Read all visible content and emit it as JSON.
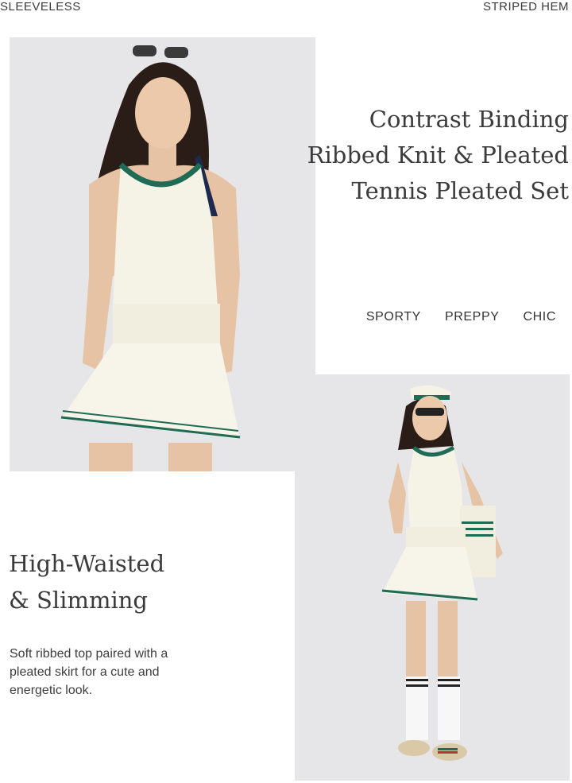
{
  "top_labels": {
    "left": "SLEEVELESS",
    "right": "STRIPED HEM"
  },
  "hero": {
    "title_lines": [
      "Contrast Binding",
      "Ribbed Knit & Pleated",
      "Tennis Pleated Set"
    ],
    "tags": [
      "SPORTY",
      "PREPPY",
      "CHIC"
    ]
  },
  "feature": {
    "title_lines": [
      "High-Waisted",
      "& Slimming"
    ],
    "description": "Soft ribbed top paired with a pleated skirt for a cute and energetic look."
  },
  "photos": {
    "photo1_alt": "Model wearing white ribbed tank top with green binding and pleated tennis skirt",
    "photo2_alt": "Model in white visor, tennis set, knee socks and sneakers holding a tote bag"
  },
  "colors": {
    "cream": "#f5f2e6",
    "green": "#1f6b55",
    "navy": "#1d2a4d",
    "backdrop": "#e6e6e8",
    "hair": "#2a1d17",
    "skin": "#e7c3a5"
  }
}
